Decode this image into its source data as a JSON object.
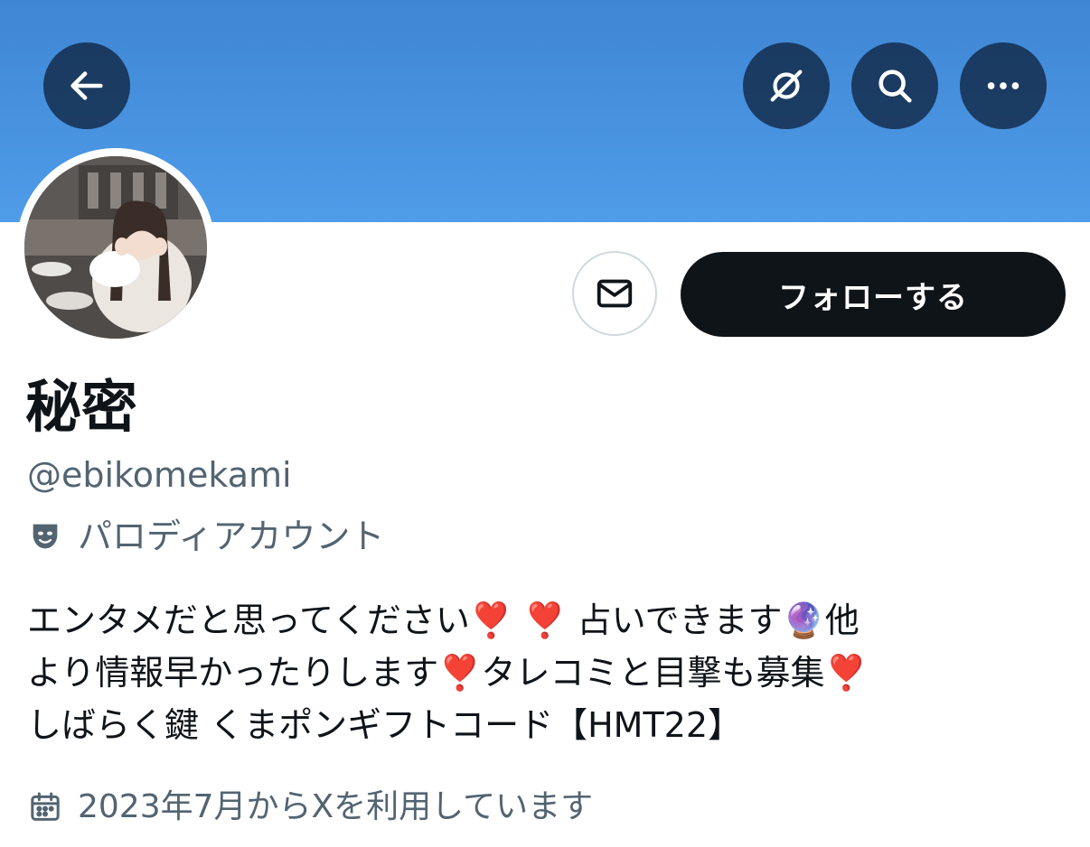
{
  "header": {
    "back_icon": "arrow-left-icon",
    "grok_icon": "grok-icon",
    "search_icon": "search-icon",
    "more_icon": "more-horizontal-icon",
    "banner_color": "#4a97e4"
  },
  "actions": {
    "message_icon": "envelope-icon",
    "follow_label": "フォローする"
  },
  "profile": {
    "display_name": "秘密",
    "handle": "@ebikomekami",
    "parody_label": "パロディアカウント",
    "bio": "エンタメだと思ってください❣️ ❣️ 占いできます🔮他\nより情報早かったりします❣️タレコミと目撃も募集❣️\nしばらく鍵 くまポンギフトコード【HMT22】",
    "joined": "2023年7月からXを利用しています"
  },
  "colors": {
    "text_primary": "#0f1419",
    "text_secondary": "#536471",
    "button_dark": "#0f1419"
  }
}
